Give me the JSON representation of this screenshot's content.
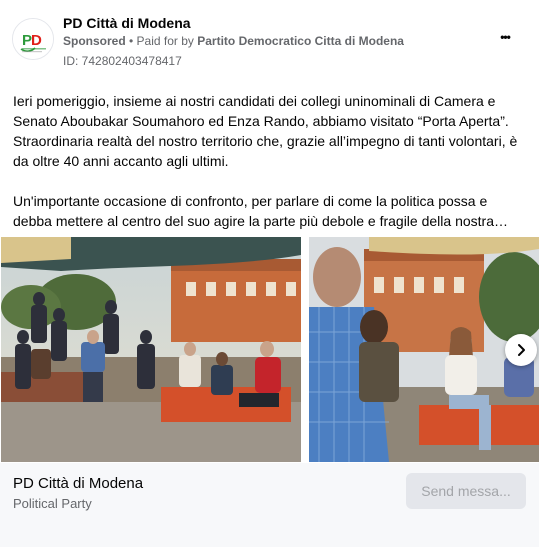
{
  "post": {
    "page_name": "PD Città di Modena",
    "sponsored_label": "Sponsored",
    "separator": " • ",
    "paid_for_prefix": "Paid for by ",
    "paid_for_by": "Partito Democratico Citta di Modena",
    "ad_id": "ID: 742802403478417",
    "more_icon_glyph": "•••",
    "avatar": {
      "text": "PD",
      "sub": "Partito Democratico",
      "colors": {
        "green": "#2e9a3c",
        "red": "#e0201a"
      }
    },
    "paragraphs": [
      "Ieri pomeriggio, insieme ai nostri candidati dei collegi uninominali di Camera e Senato Aboubakar Soumahoro ed Enza Rando, abbiamo visitato “Porta Aperta”. Straordinaria realtà del nostro territorio che, grazie all’impegno di tanti volontari, è da oltre 40 anni accanto agli ultimi.",
      "Un'importante occasione di confronto, per parlare di come la politica possa e debba mettere al centro del suo agire la parte più debole e fragile della nostra…"
    ]
  },
  "carousel": {
    "slides": [
      {
        "description": ""
      },
      {
        "description": ""
      }
    ],
    "next_icon": "chevron-right-icon"
  },
  "footer": {
    "title": "PD Città di Modena",
    "subtitle": "Political Party",
    "send_label": "Send messa..."
  },
  "colors": {
    "text_primary": "#050505",
    "text_secondary": "#65676b",
    "footer_bg": "#f7f8fa",
    "button_disabled_bg": "#e4e6eb",
    "button_disabled_text": "#a3a5a9"
  }
}
